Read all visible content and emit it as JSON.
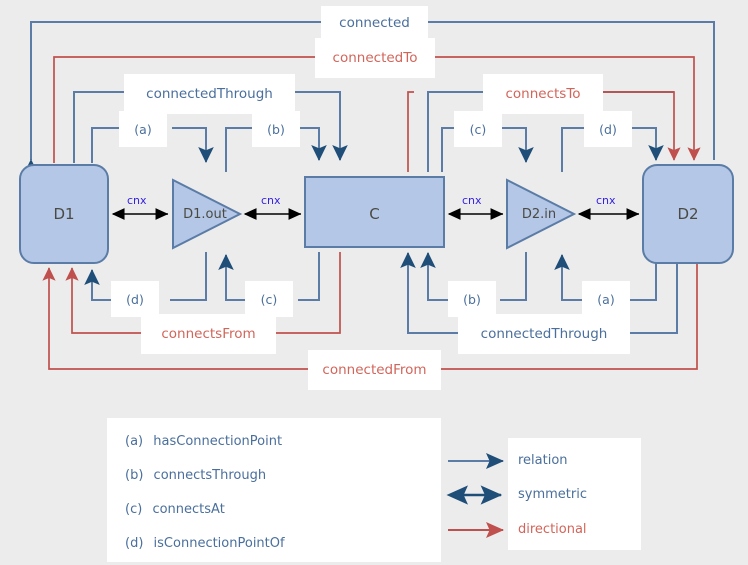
{
  "title": "connection relations diagram",
  "nodes": [
    {
      "id": "D1",
      "label": "D1",
      "shape": "rounded-rect"
    },
    {
      "id": "D1.out",
      "label": "D1.out",
      "shape": "triangle-right"
    },
    {
      "id": "C",
      "label": "C",
      "shape": "rect"
    },
    {
      "id": "D2.in",
      "label": "D2.in",
      "shape": "triangle-right"
    },
    {
      "id": "D2",
      "label": "D2",
      "shape": "rounded-rect"
    }
  ],
  "inline_edge_labels": [
    {
      "id": "cnx1",
      "text": "cnx"
    },
    {
      "id": "cnx2",
      "text": "cnx"
    },
    {
      "id": "cnx3",
      "text": "cnx"
    },
    {
      "id": "cnx4",
      "text": "cnx"
    }
  ],
  "edge_labels": {
    "connected": "connected",
    "connectedTo": "connectedTo",
    "connectedThrough_top": "connectedThrough",
    "connectsTo": "connectsTo",
    "a_top": "(a)",
    "b_top": "(b)",
    "c_top": "(c)",
    "d_top": "(d)",
    "d_bottom": "(d)",
    "c_bottom": "(c)",
    "b_bottom": "(b)",
    "a_bottom": "(a)",
    "connectsFrom": "connectsFrom",
    "connectedThrough_bottom": "connectedThrough",
    "connectedFrom": "connectedFrom"
  },
  "legend_relations": [
    {
      "key": "(a)",
      "name": "hasConnectionPoint"
    },
    {
      "key": "(b)",
      "name": "connectsThrough"
    },
    {
      "key": "(c)",
      "name": "connectsAt"
    },
    {
      "key": "(d)",
      "name": "isConnectionPointOf"
    }
  ],
  "legend_line_types": [
    {
      "name": "relation",
      "color": "#4a6f9c",
      "arrow": "single"
    },
    {
      "name": "symmetric",
      "color": "#1f4e79",
      "arrow": "double"
    },
    {
      "name": "directional",
      "color": "#d2655a",
      "arrow": "single"
    }
  ],
  "colors": {
    "background": "#ececec",
    "node_fill": "#b4c7e7",
    "node_stroke": "#5b7ca6",
    "relation_blue": "#5b7ca6",
    "arrow_navy": "#1f4e79",
    "directional_red": "#d2655a",
    "label_text_blue": "#4a6f9c",
    "cnx_text": "#3322dd",
    "node_label_text": "#4a4a42"
  }
}
